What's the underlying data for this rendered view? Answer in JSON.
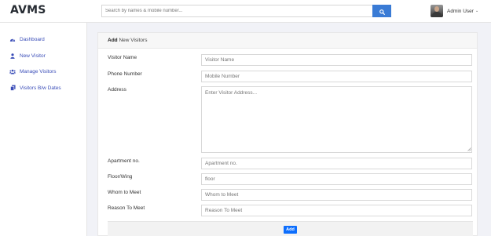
{
  "app": {
    "brand": "AVMS"
  },
  "search": {
    "placeholder": "Search by names & mobile number...",
    "icon": "search-icon"
  },
  "user": {
    "name": "Admin User",
    "caret": "⌄"
  },
  "sidebar": {
    "items": [
      {
        "label": "Dashboard",
        "icon": "dashboard-icon"
      },
      {
        "label": "New Visitor",
        "icon": "user-icon"
      },
      {
        "label": "Manage Visitors",
        "icon": "users-icon"
      },
      {
        "label": "Visitors B/w Dates",
        "icon": "copy-icon"
      }
    ]
  },
  "form": {
    "header_strong": "Add",
    "header_rest": " New Visitors",
    "fields": [
      {
        "label": "Visitor Name",
        "placeholder": "Visitor Name"
      },
      {
        "label": "Phone Number",
        "placeholder": "Mobile Number"
      },
      {
        "label": "Address",
        "placeholder": "Enter Visitor Address..."
      },
      {
        "label": "Apartment no.",
        "placeholder": "Apartment no."
      },
      {
        "label": "Floor/Wing",
        "placeholder": "floor"
      },
      {
        "label": "Whom to Meet",
        "placeholder": "Whom to Meet"
      },
      {
        "label": "Reason To Meet",
        "placeholder": "Reason To Meet"
      }
    ],
    "submit_label": "Add"
  },
  "colors": {
    "accent": "#3a7bd5",
    "link": "#3a4db8",
    "button": "#0d6efd",
    "background": "#f1f2f7"
  }
}
